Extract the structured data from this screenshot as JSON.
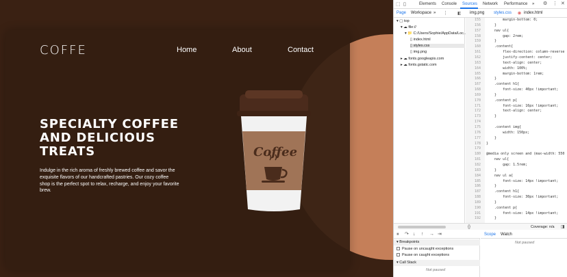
{
  "site": {
    "logo": "COFFE",
    "nav": [
      "Home",
      "About",
      "Contact"
    ],
    "headline": "Specialty Coffee and Delicious Treats",
    "description": "Indulge in the rich aroma of freshly brewed coffee and savor the exquisite flavors of our handcrafted pastries. Our cozy coffee shop is the perfect spot to relax, recharge, and enjoy your favorite brew.",
    "cup_label": "Coffee",
    "colors": {
      "background": "#3a2113",
      "card": "#341e11",
      "accent": "#c57f59"
    }
  },
  "devtools": {
    "tabs": [
      "Elements",
      "Console",
      "Sources",
      "Network",
      "Performance"
    ],
    "active_tab": "Sources",
    "more_tabs": "»",
    "sub_tabs": {
      "page": "Page",
      "workspace": "Workspace",
      "more": "»"
    },
    "open_files": [
      "img.png",
      "styles.css",
      "index.html"
    ],
    "tree": {
      "top": "top",
      "origin": "file://",
      "folder": "C:/Users/Sophie/AppData/Loc...",
      "files": [
        "index.html",
        "styles.css",
        "img.png"
      ],
      "fonts": [
        "fonts.googleapis.com",
        "fonts.gstatic.com"
      ]
    },
    "code_lines": [
      {
        "n": "155",
        "code": "        margin-bottom: 0;"
      },
      {
        "n": "156",
        "code": "    }"
      },
      {
        "n": "157",
        "code": "    nav ul{"
      },
      {
        "n": "158",
        "code": "        gap: 2rem;"
      },
      {
        "n": "159",
        "code": "    }"
      },
      {
        "n": "160",
        "code": "    .content{"
      },
      {
        "n": "161",
        "code": "        flex-direction: column-reverse"
      },
      {
        "n": "162",
        "code": "        justify-content: center;"
      },
      {
        "n": "163",
        "code": "        text-align: center;"
      },
      {
        "n": "164",
        "code": "        width: 100%;"
      },
      {
        "n": "165",
        "code": "        margin-bottom: 1rem;"
      },
      {
        "n": "166",
        "code": "    }"
      },
      {
        "n": "167",
        "code": "    .content h1{"
      },
      {
        "n": "168",
        "code": "        font-size: 40px !important;"
      },
      {
        "n": "169",
        "code": "    }"
      },
      {
        "n": "170",
        "code": "    .content p{"
      },
      {
        "n": "171",
        "code": "        font-size: 16px !important;"
      },
      {
        "n": "172",
        "code": "        text-align: center;"
      },
      {
        "n": "173",
        "code": "    }"
      },
      {
        "n": "174",
        "code": ""
      },
      {
        "n": "175",
        "code": "    .content img{"
      },
      {
        "n": "176",
        "code": "        width: 150px;"
      },
      {
        "n": "177",
        "code": "    }"
      },
      {
        "n": "178",
        "code": "}"
      },
      {
        "n": "179",
        "code": ""
      },
      {
        "n": "180",
        "code": "@media only screen and (max-width: 550"
      },
      {
        "n": "181",
        "code": "    nav ul{"
      },
      {
        "n": "182",
        "code": "        gap: 1.5rem;"
      },
      {
        "n": "183",
        "code": "    }"
      },
      {
        "n": "184",
        "code": "    nav ul a{"
      },
      {
        "n": "185",
        "code": "        font-size: 14px !important;"
      },
      {
        "n": "186",
        "code": "    }"
      },
      {
        "n": "187",
        "code": "    .content h1{"
      },
      {
        "n": "188",
        "code": "        font-size: 30px !important;"
      },
      {
        "n": "189",
        "code": "    }"
      },
      {
        "n": "190",
        "code": "    .content p{"
      },
      {
        "n": "191",
        "code": "        font-size: 14px !important;"
      },
      {
        "n": "192",
        "code": "    }"
      }
    ],
    "status": {
      "format": "{}",
      "coverage": "Coverage: n/a"
    },
    "breakpoints_header": "Breakpoints",
    "pause_uncaught": "Pause on uncaught exceptions",
    "pause_caught": "Pause on caught exceptions",
    "callstack_header": "Call Stack",
    "not_paused": "Not paused",
    "scope_tab": "Scope",
    "watch_tab": "Watch"
  }
}
